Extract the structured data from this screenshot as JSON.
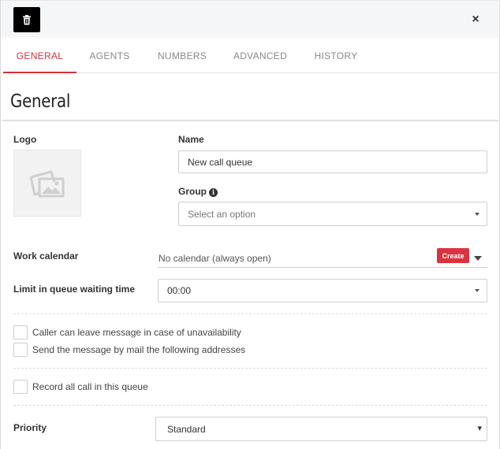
{
  "header": {
    "delete_icon": "trash-icon",
    "close_glyph": "×"
  },
  "tabs": [
    {
      "label": "GENERAL",
      "active": true
    },
    {
      "label": "AGENTS",
      "active": false
    },
    {
      "label": "NUMBERS",
      "active": false
    },
    {
      "label": "ADVANCED",
      "active": false
    },
    {
      "label": "HISTORY",
      "active": false
    }
  ],
  "section_title": "General",
  "logo": {
    "label": "Logo",
    "icon": "image-placeholder-icon"
  },
  "name": {
    "label": "Name",
    "value": "New call queue"
  },
  "group": {
    "label": "Group",
    "info_glyph": "i",
    "placeholder": "Select an option"
  },
  "work_calendar": {
    "label": "Work calendar",
    "value": "No calendar (always open)",
    "create_label": "Create"
  },
  "limit_wait": {
    "label": "Limit in queue waiting time",
    "value": "00:00"
  },
  "options": {
    "leave_message": "Caller can leave message in case of unavailability",
    "send_mail": "Send the message by mail the following addresses",
    "record_calls": "Record all call in this queue"
  },
  "priority": {
    "label": "Priority",
    "value": "Standard",
    "caret": "▾"
  },
  "colors": {
    "accent": "#d0323b",
    "create_button": "#d9333f",
    "topbar": "#f5f6f7"
  }
}
